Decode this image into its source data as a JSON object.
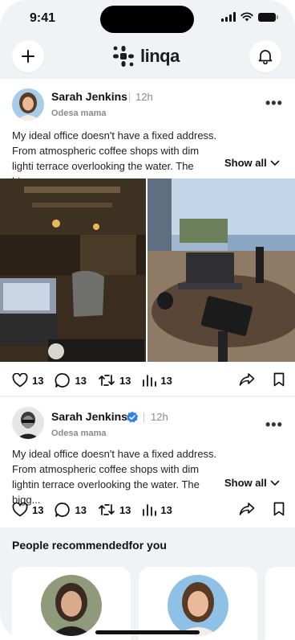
{
  "status": {
    "time": "9:41"
  },
  "header": {
    "logo_text": "linqa",
    "add_icon": "plus-icon",
    "bell_icon": "bell-icon",
    "brand_color": "#1d1d1f"
  },
  "posts": [
    {
      "author": "Sarah Jenkins",
      "verified": false,
      "time_ago": "12h",
      "subtitle": "Odesa mama",
      "text": "My ideal office doesn't have a fixed address. From atmospheric coffee shops with dim lighti terrace overlooking the water. The bige...",
      "show_all": "Show all",
      "likes": "13",
      "comments": "13",
      "reposts": "13",
      "views": "13"
    },
    {
      "author": "Sarah Jenkins",
      "verified": true,
      "time_ago": "12h",
      "subtitle": "Odesa mama",
      "text": "My ideal office doesn't have a fixed address. From atmospheric coffee shops with dim lightin terrace overlooking the water. The bigg...",
      "show_all": "Show all",
      "likes": "13",
      "comments": "13",
      "reposts": "13",
      "views": "13"
    }
  ],
  "recommended": {
    "title": "People recommendedfor you"
  },
  "colors": {
    "verified": "#2f80ed",
    "background": "#f1f2f6"
  }
}
